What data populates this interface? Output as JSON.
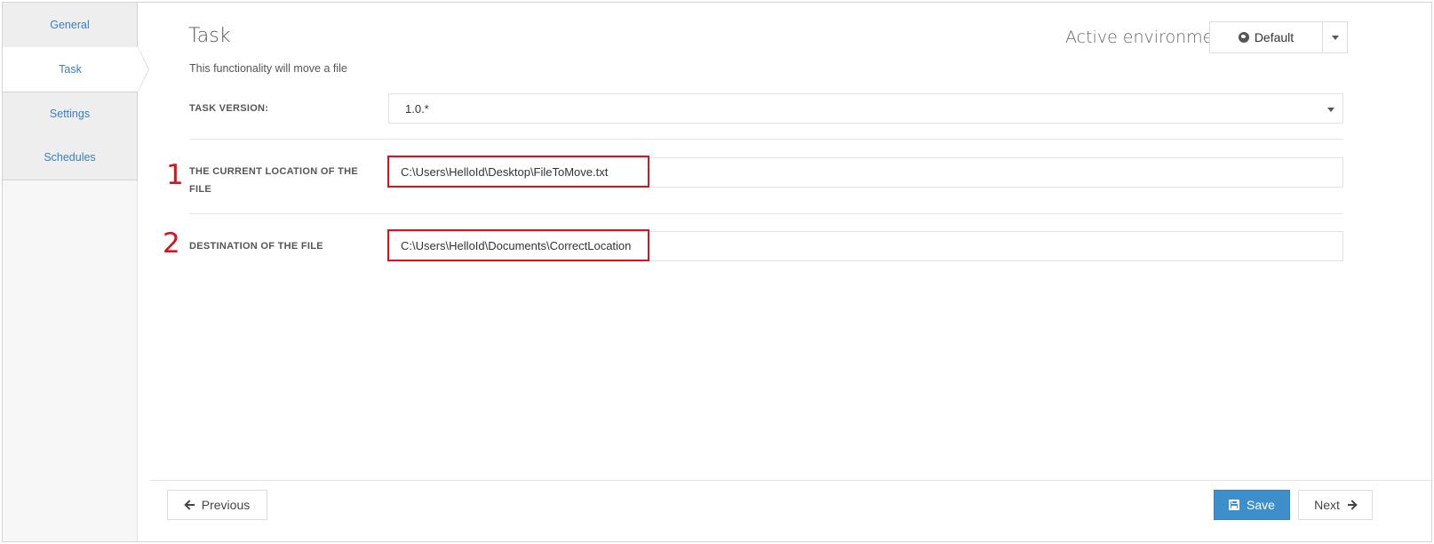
{
  "sidebar": {
    "tabs": [
      {
        "label": "General",
        "active": false
      },
      {
        "label": "Task",
        "active": true
      },
      {
        "label": "Settings",
        "active": false
      },
      {
        "label": "Schedules",
        "active": false
      }
    ]
  },
  "header": {
    "title": "Task",
    "subtitle": "This functionality will move a file",
    "environment_label": "Active environment",
    "environment_value": "Default",
    "environment_icon": "globe-icon"
  },
  "form": {
    "task_version": {
      "label": "TASK VERSION:",
      "value": "1.0.*"
    },
    "current_location": {
      "label": "THE CURRENT LOCATION OF THE FILE",
      "value": "C:\\Users\\HelloId\\Desktop\\FileToMove.txt",
      "annotation": "1"
    },
    "destination": {
      "label": "DESTINATION OF THE FILE",
      "value": "C:\\Users\\HelloId\\Documents\\CorrectLocation",
      "annotation": "2"
    }
  },
  "footer": {
    "previous_label": "Previous",
    "save_label": "Save",
    "next_label": "Next"
  },
  "colors": {
    "link": "#3a7fc1",
    "primary": "#3d8fcb",
    "annotation": "#d9121f"
  }
}
